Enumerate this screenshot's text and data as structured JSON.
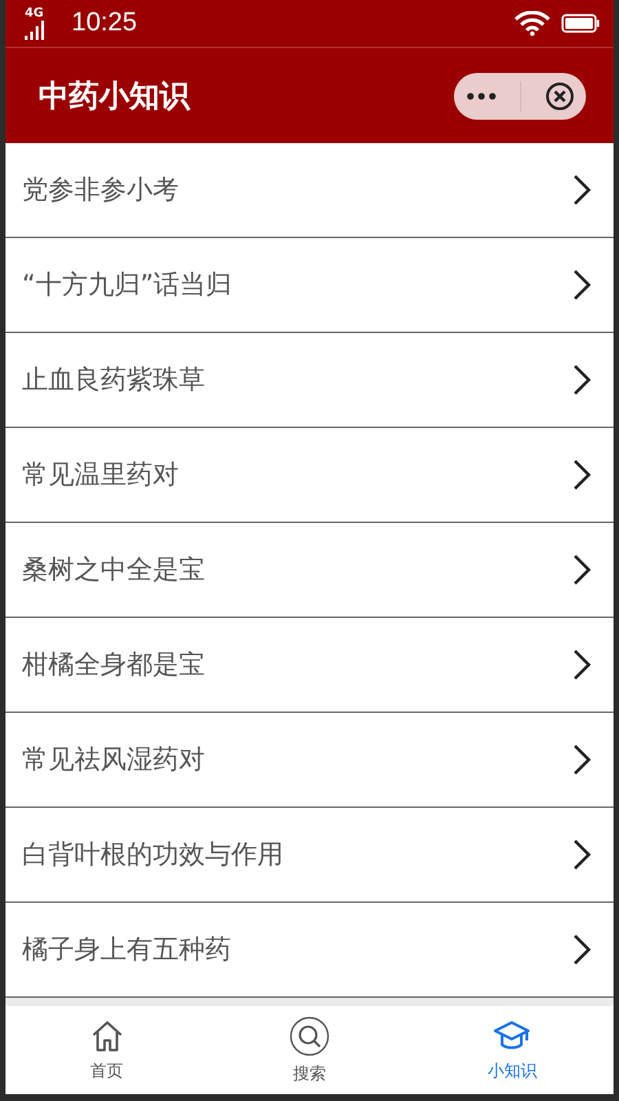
{
  "status_bar": {
    "network": "4G",
    "time": "10:25"
  },
  "header": {
    "title": "中药小知识"
  },
  "items": [
    {
      "label": "党参非参小考"
    },
    {
      "label": "“十方九归”话当归"
    },
    {
      "label": "止血良药紫珠草"
    },
    {
      "label": "常见温里药对"
    },
    {
      "label": "桑树之中全是宝"
    },
    {
      "label": "柑橘全身都是宝"
    },
    {
      "label": "常见祛风湿药对"
    },
    {
      "label": "白背叶根的功效与作用"
    },
    {
      "label": "橘子身上有五种药"
    }
  ],
  "tabs": [
    {
      "label": "首页",
      "kind": "home",
      "selected": false
    },
    {
      "label": "搜索",
      "kind": "search",
      "selected": false
    },
    {
      "label": "小知识",
      "kind": "learn",
      "selected": true
    }
  ]
}
